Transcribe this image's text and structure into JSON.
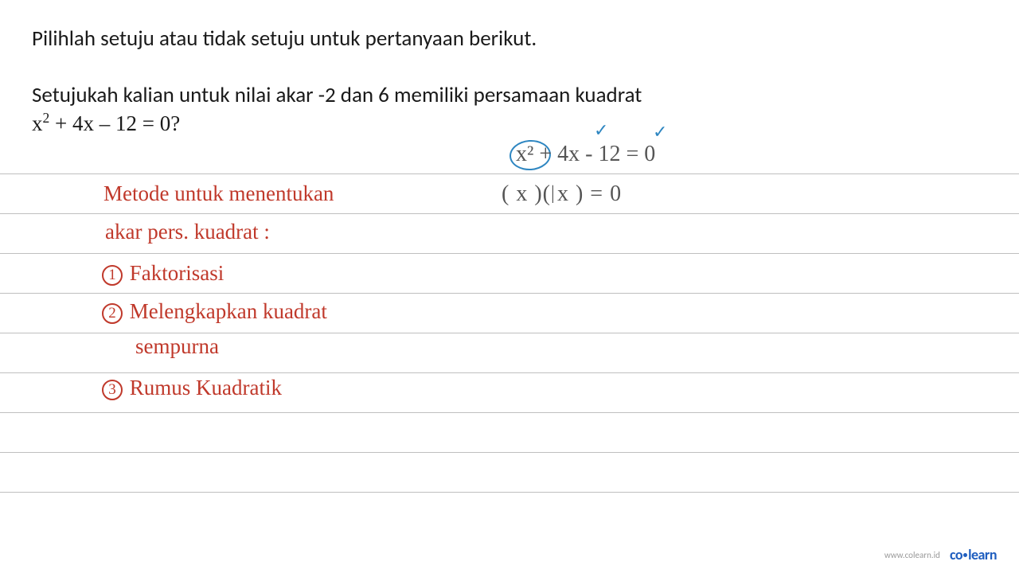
{
  "printed": {
    "line1": "Pilihlah setuju atau tidak setuju untuk pertanyaan berikut.",
    "line2": "Setujukah kalian untuk nilai akar -2 dan 6 memiliki persamaan kuadrat",
    "eq_html": "x² + 4x – 12 = 0?"
  },
  "hand_red": {
    "title1": "Metode untuk menentukan",
    "title2": "akar pers. kuadrat :",
    "item1": "Faktorisasi",
    "item2a": "Melengkapkan kuadrat",
    "item2b": "sempurna",
    "item3": "Rumus Kuadratik"
  },
  "hand_gray": {
    "eq1": "x² + 4x - 12 = 0",
    "eq2": "( x      )( x        ) = 0",
    "bar_in_paren": "|"
  },
  "footer": {
    "url": "www.colearn.id",
    "brand_a": "co",
    "brand_b": "learn"
  }
}
